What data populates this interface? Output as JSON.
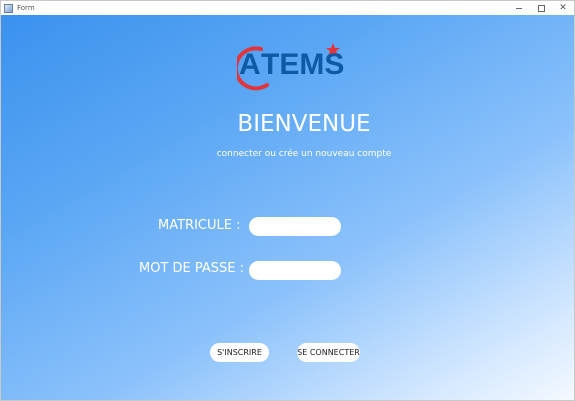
{
  "window": {
    "title": "Form",
    "icon": "app-form-icon",
    "controls": {
      "minimize": "minimize-icon",
      "maximize": "maximize-icon",
      "close": "close-icon",
      "close_glyph": "✕"
    }
  },
  "logo": {
    "text": "ATEMS",
    "lead_letter": "A",
    "rest_letters": "TEMS",
    "ring_color": "#e2343a",
    "star_color": "#e2343a",
    "letters_color": "#0f5aa5"
  },
  "welcome": {
    "title": "BIENVENUE",
    "subtitle": "connecter ou crée un nouveau compte"
  },
  "form": {
    "matricule_label": "MATRICULE :",
    "matricule_value": "",
    "password_label": "MOT DE PASSE :",
    "password_value": ""
  },
  "buttons": {
    "signup_label": "S'INSCRIRE",
    "login_label": "SE CONNECTER"
  },
  "colors": {
    "background_start": "#3a92ee",
    "background_end": "#f4f9ff",
    "text": "#ffffff"
  }
}
